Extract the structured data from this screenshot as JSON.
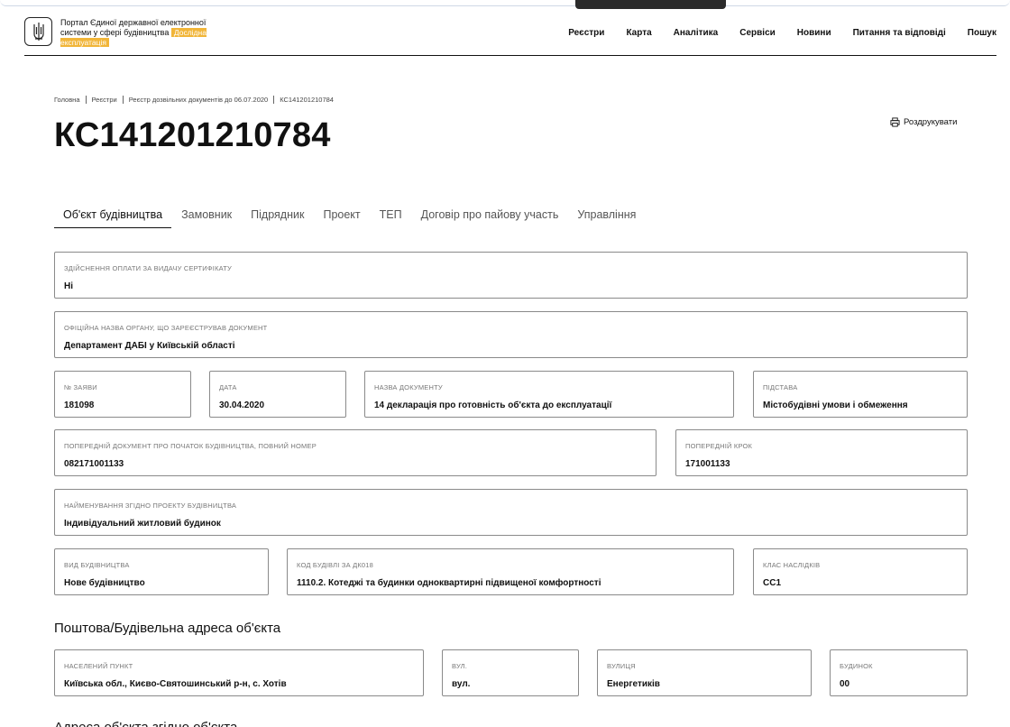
{
  "header": {
    "portal_title": "Портал Єдиної державної електронної системи у сфері будівництва",
    "beta_badge": "Дослідна експлуатація",
    "nav": [
      "Реєстри",
      "Карта",
      "Аналітика",
      "Сервіси",
      "Новини",
      "Питання та відповіді",
      "Пошук"
    ]
  },
  "breadcrumb": [
    "Головна",
    "Реєстри",
    "Реєстр дозвільних документів до 06.07.2020",
    "КС141201210784"
  ],
  "page_title": "КС141201210784",
  "print_label": "Роздрукувати",
  "tabs": [
    "Об'єкт будівництва",
    "Замовник",
    "Підрядник",
    "Проект",
    "ТЕП",
    "Договір про пайову участь",
    "Управління"
  ],
  "fields": {
    "payment": {
      "label": "Здійснення оплати за видачу сертифікату",
      "value": "Ні"
    },
    "authority": {
      "label": "Офіційна назва органу, що зареєстрував документ",
      "value": "Департамент ДАБІ у Київській області"
    },
    "app_no": {
      "label": "№ заяви",
      "value": "181098"
    },
    "date": {
      "label": "Дата",
      "value": "30.04.2020"
    },
    "doc_name": {
      "label": "Назва документу",
      "value": "14 декларація про готовність об'єкта до експлуатації"
    },
    "basis": {
      "label": "Підстава",
      "value": "Містобудівні умови і обмеження"
    },
    "prev_doc": {
      "label": "Попередній документ про початок будівництва, повний номер",
      "value": "082171001133"
    },
    "prev_step": {
      "label": "Попередній крок",
      "value": "171001133"
    },
    "project_name": {
      "label": "Найменування згідно проекту будівництва",
      "value": "Індивідуальний житловий будинок"
    },
    "build_type": {
      "label": "Вид будівництва",
      "value": "Нове будівництво"
    },
    "build_code": {
      "label": "Код будівлі за ДК018",
      "value": "1110.2. Котеджі та будинки одноквартирні підвищеної комфортності"
    },
    "class": {
      "label": "Клас наслідків",
      "value": "СС1"
    }
  },
  "address_section": {
    "title": "Поштова/Будівельна адреса об'єкта",
    "settlement": {
      "label": "Населений пункт",
      "value": "Київська обл., Києво-Святошинський р-н, с. Хотів"
    },
    "street_type": {
      "label": "Вул.",
      "value": "вул."
    },
    "street": {
      "label": "Вулиця",
      "value": "Енергетиків"
    },
    "house": {
      "label": "Будинок",
      "value": "00"
    }
  },
  "next_section_title": "Адреса об'єкта згідно об'єкта"
}
